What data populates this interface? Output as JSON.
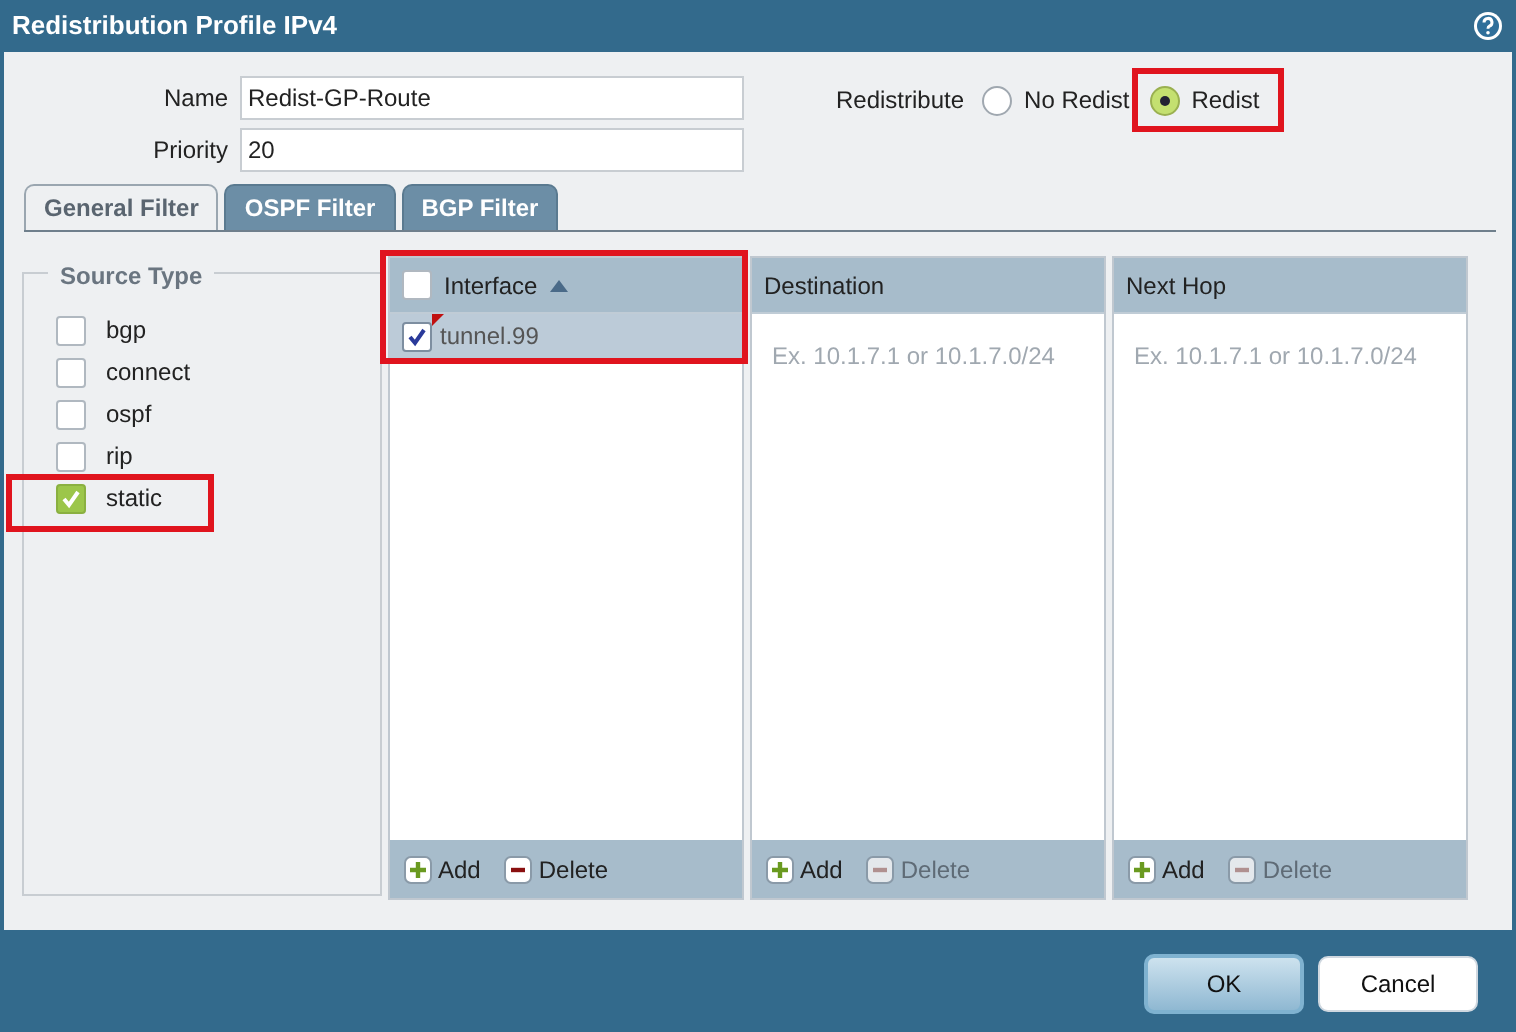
{
  "window": {
    "title": "Redistribution Profile IPv4"
  },
  "fields": [
    {
      "label": "Name",
      "value": "Redist-GP-Route"
    },
    {
      "label": "Priority",
      "value": "20"
    }
  ],
  "redistribute": {
    "label": "Redistribute",
    "options": [
      {
        "label": "No Redist",
        "selected": false,
        "highlighted": false
      },
      {
        "label": "Redist",
        "selected": true,
        "highlighted": true
      }
    ]
  },
  "tabs": [
    {
      "label": "General Filter",
      "selected": true
    },
    {
      "label": "OSPF Filter",
      "selected": false
    },
    {
      "label": "BGP Filter",
      "selected": false
    }
  ],
  "source_type": {
    "title": "Source Type",
    "items": [
      {
        "label": "bgp",
        "checked": false,
        "highlighted": false
      },
      {
        "label": "connect",
        "checked": false,
        "highlighted": false
      },
      {
        "label": "ospf",
        "checked": false,
        "highlighted": false
      },
      {
        "label": "rip",
        "checked": false,
        "highlighted": false
      },
      {
        "label": "static",
        "checked": true,
        "highlighted": true
      }
    ]
  },
  "grids": [
    {
      "header": "Interface",
      "kind": "checklist",
      "select_all": false,
      "sort_ascending": true,
      "highlighted": true,
      "rows": [
        {
          "text": "tunnel.99",
          "checked": true,
          "selected": true,
          "modified": true
        }
      ],
      "actions": [
        {
          "label": "Add",
          "kind": "add",
          "disabled": false
        },
        {
          "label": "Delete",
          "kind": "delete",
          "disabled": false
        }
      ]
    },
    {
      "header": "Destination",
      "kind": "text",
      "highlighted": false,
      "placeholder": "Ex. 10.1.7.1 or 10.1.7.0/24",
      "actions": [
        {
          "label": "Add",
          "kind": "add",
          "disabled": false
        },
        {
          "label": "Delete",
          "kind": "delete",
          "disabled": true
        }
      ]
    },
    {
      "header": "Next Hop",
      "kind": "text",
      "highlighted": false,
      "placeholder": "Ex. 10.1.7.1 or 10.1.7.0/24",
      "actions": [
        {
          "label": "Add",
          "kind": "add",
          "disabled": false
        },
        {
          "label": "Delete",
          "kind": "delete",
          "disabled": true
        }
      ]
    }
  ],
  "buttons": [
    {
      "label": "OK",
      "kind": "primary"
    },
    {
      "label": "Cancel",
      "kind": "secondary"
    }
  ]
}
